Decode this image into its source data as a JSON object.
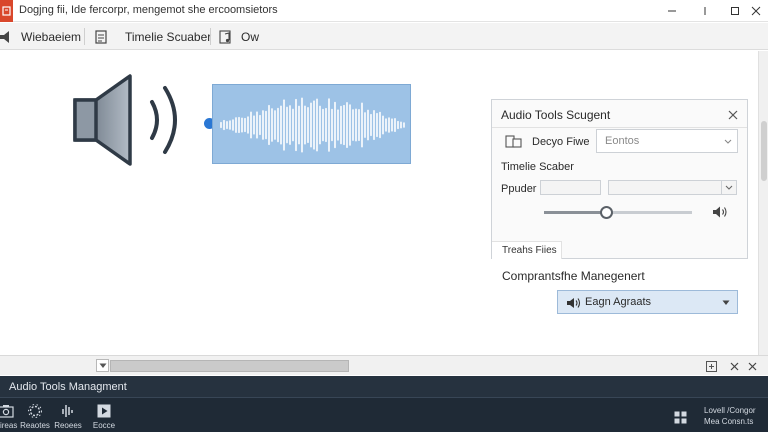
{
  "window": {
    "title": "Dogjng fii, Ide fercorpr, mengemot she ercoomsietors"
  },
  "toolbar": {
    "items": [
      {
        "label": "Wiebaeiem",
        "icon": "speaker-icon"
      },
      {
        "label": "Timelie Scuaber",
        "icon": "document-icon"
      },
      {
        "label": "Ow",
        "icon": "music-note-icon"
      }
    ]
  },
  "panel": {
    "title": "Audio Tools Scugent",
    "device_label": "Decyo Fiwe",
    "device_select_value": "Eontos",
    "timeline_label": "Timelie Scaber",
    "power_label": "Ppuder",
    "volume_level": 0.42,
    "tab_label": "Treahs Fiies"
  },
  "section": {
    "label": "Comprantsfhe Manegenert",
    "dropdown_label": "Eagn Agraats"
  },
  "bottom_panel": {
    "title": "Audio Tools Managment",
    "tools": [
      {
        "label": "Pireas",
        "icon": "camera-icon"
      },
      {
        "label": "Reaotes",
        "icon": "gear-icon"
      },
      {
        "label": "Reoees",
        "icon": "waveform-icon"
      },
      {
        "label": "Eocce",
        "icon": "play-icon"
      }
    ],
    "status_line1": "Lovell /Congor",
    "status_line2": "Mea   Consn.ts"
  },
  "colors": {
    "accent": "#2a77d4",
    "waveform_bg": "#9dc2e6",
    "app_badge": "#d9472b",
    "bottom_panel_bg": "#1f2a36"
  }
}
